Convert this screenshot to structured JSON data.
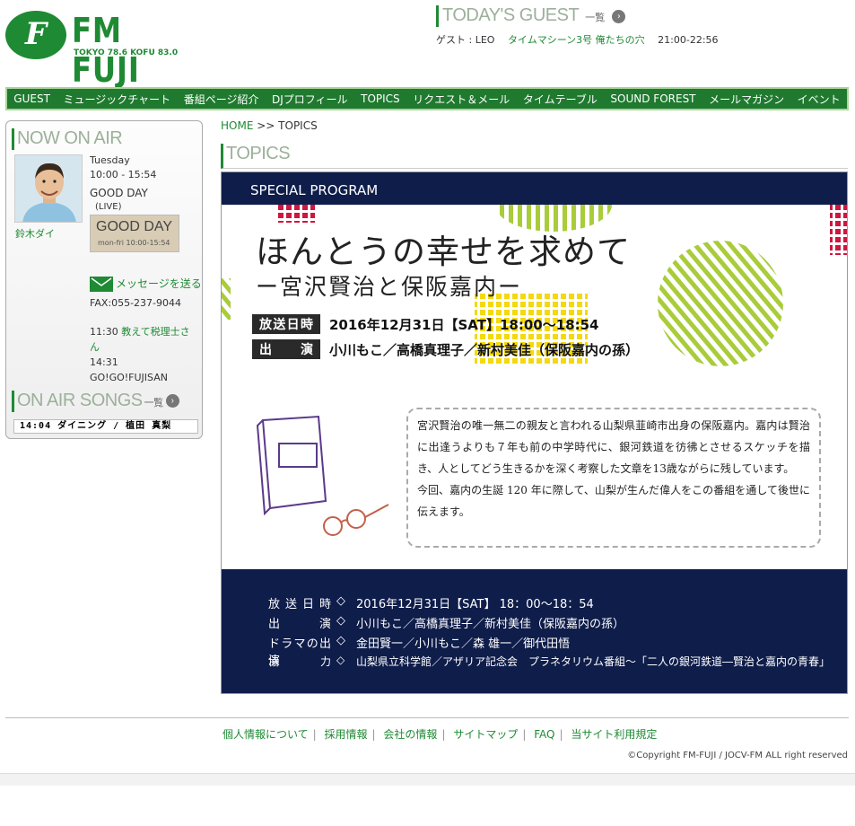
{
  "header": {
    "logo_text": "FM FUJI",
    "logo_mark": "F",
    "logo_sub": "TOKYO 78.6  KOFU 83.0",
    "guest_title": "TODAY'S GUEST",
    "guest_more": "一覧",
    "guest_line_prefix": "ゲスト : LEO",
    "guest_program": "タイムマシーン3号 俺たちの穴",
    "guest_time": "21:00-22:56"
  },
  "nav": [
    "GUEST",
    "ミュージックチャート",
    "番組ページ紹介",
    "DJプロフィール",
    "TOPICS",
    "リクエスト＆メール",
    "タイムテーブル",
    "SOUND FOREST",
    "メールマガジン",
    "イベント"
  ],
  "sidebar": {
    "now_on_air": "NOW ON AIR",
    "dj_name": "鈴木ダイ",
    "day": "Tuesday",
    "time": "10:00 - 15:54",
    "program": "GOOD DAY",
    "live": "(LIVE)",
    "banner_title": "GOOD DAY",
    "banner_sub": "mon-fri  10:00-15:54",
    "message_link": "メッセージを送る",
    "fax": "FAX:055-237-9044",
    "sched1_time": "11:30",
    "sched1_title": "教えて税理士さん",
    "sched2_time": "14:31",
    "sched2_title": "GO!GO!FUJISAN",
    "songs_title": "ON AIR SONGS",
    "songs_more": "一覧",
    "songs_ticker": "14:04 ダイニング / 植田 真梨"
  },
  "breadcrumb": {
    "home": "HOME",
    "sep": ">>",
    "current": "TOPICS"
  },
  "topics_title": "TOPICS",
  "poster": {
    "label": "SPECIAL PROGRAM",
    "title": "ほんとうの幸せを求めて",
    "subtitle": "ー宮沢賢治と保阪嘉内ー",
    "broadcast_label": "放送日時",
    "broadcast_value": "2016年12月31日【SAT】18:00～18:54",
    "cast_label": "出演",
    "cast_value": "小川もこ／高橋真理子／新村美佳（保阪嘉内の孫）",
    "description": "宮沢賢治の唯一無二の親友と言われる山梨県韮崎市出身の保阪嘉内。嘉内は賢治に出逢うよりも７年も前の中学時代に、銀河鉄道を彷彿とさせるスケッチを描き、人としてどう生きるかを深く考察した文章を13歳ながらに残しています。",
    "description2": "今回、嘉内の生誕 120 年に際して、山梨が生んだ偉人をこの番組を通して後世に伝えます。",
    "credits": [
      {
        "label": "放送日時",
        "value": "2016年12月31日【SAT】 18：00～18：54"
      },
      {
        "label": "出演",
        "value": "小川もこ／高橋真理子／新村美佳（保阪嘉内の孫）"
      },
      {
        "label": "ドラマの出演",
        "value": "金田賢一／小川もこ／森 雄一／御代田悟"
      },
      {
        "label": "協力",
        "value": "山梨県立科学館／アザリア記念会　プラネタリウム番組～「二人の銀河鉄道―賢治と嘉内の青春」"
      }
    ],
    "diamond": "◇"
  },
  "footer": {
    "links": [
      "個人情報について",
      "採用情報",
      "会社の情報",
      "サイトマップ",
      "FAQ",
      "当サイト利用規定"
    ],
    "copyright": "©Copyright FM-FUJI / JOCV-FM ALL right reserved"
  },
  "colors": {
    "brand_green": "#1f8a34",
    "navy": "#0f1d4a"
  }
}
